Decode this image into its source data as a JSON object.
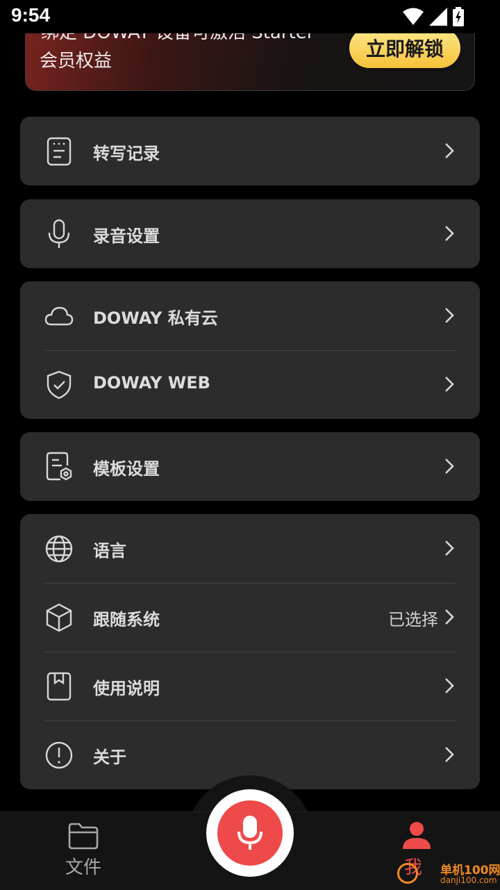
{
  "status_bar": {
    "time": "9:54"
  },
  "banner": {
    "line1": "绑定 DOWAY 设备可激活 Starter",
    "line2": "会员权益",
    "unlock_label": "立即解锁"
  },
  "menu": {
    "transcript_records": "转写记录",
    "recording_settings": "录音设置",
    "private_cloud": "DOWAY 私有云",
    "doway_web": "DOWAY WEB",
    "template_settings": "模板设置",
    "language": "语言",
    "follow_system": "跟随系统",
    "follow_system_value": "已选择",
    "user_guide": "使用说明",
    "about": "关于"
  },
  "bottom_nav": {
    "files_label": "文件",
    "me_label": "我"
  },
  "watermark": {
    "title": "单机100网",
    "url": "danji100.com"
  },
  "colors": {
    "accent_red": "#ef4a4a",
    "unlock_gold": "#f5c23a",
    "card_bg": "#2c2c2c"
  }
}
